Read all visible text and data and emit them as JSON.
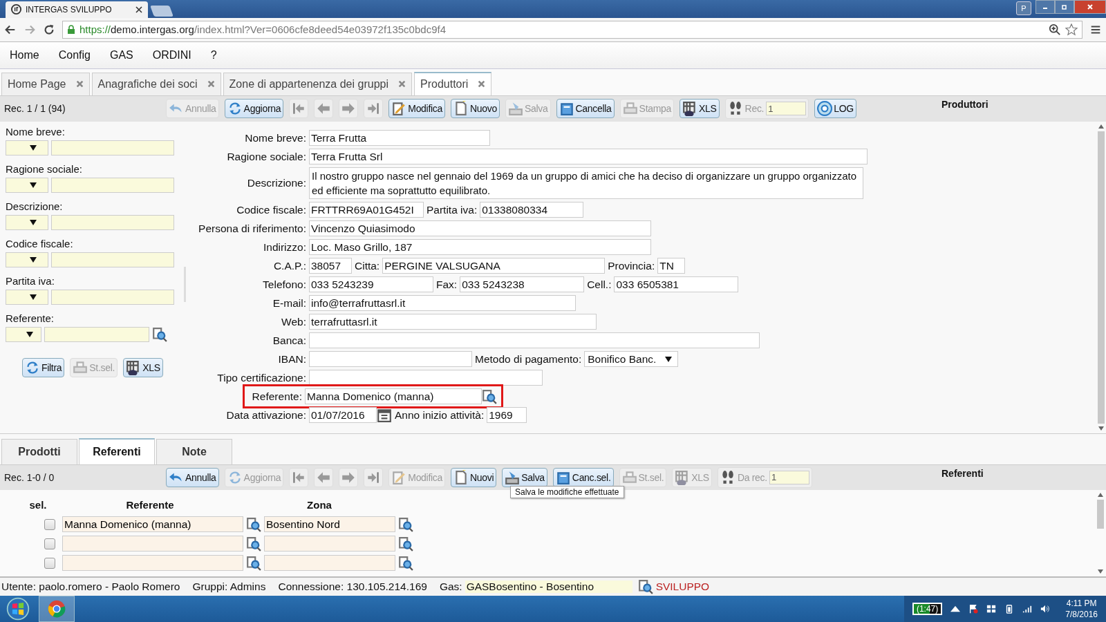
{
  "browser": {
    "tab_title": "INTERGAS SVILUPPO",
    "profile": "P",
    "url_scheme": "https://",
    "url_host": "demo.intergas.org",
    "url_path": "/index.html?Ver=0606cfe8deed54e03972f135c0bdc9f4"
  },
  "menu": [
    "Home",
    "Config",
    "GAS",
    "ORDINI",
    "?"
  ],
  "tabs": [
    {
      "label": "Home Page",
      "selected": false
    },
    {
      "label": "Anagrafiche dei soci",
      "selected": false
    },
    {
      "label": "Zone di appartenenza dei gruppi",
      "selected": false
    },
    {
      "label": "Produttori",
      "selected": true
    }
  ],
  "toolbar": {
    "record": "Rec. 1 / 1 (94)",
    "title": "Produttori",
    "items": [
      {
        "kind": "button",
        "label": "Annulla",
        "disabled": true
      },
      {
        "kind": "button",
        "label": "Aggiorna",
        "disabled": false
      },
      {
        "kind": "nav"
      },
      {
        "kind": "nav"
      },
      {
        "kind": "nav"
      },
      {
        "kind": "nav"
      },
      {
        "kind": "button",
        "label": "Modifica",
        "disabled": false
      },
      {
        "kind": "button",
        "label": "Nuovo",
        "disabled": false
      },
      {
        "kind": "button",
        "label": "Salva",
        "disabled": true
      },
      {
        "kind": "button",
        "label": "Cancella",
        "disabled": false
      },
      {
        "kind": "button",
        "label": "Stampa",
        "disabled": true
      },
      {
        "kind": "button",
        "label": "XLS",
        "disabled": false
      },
      {
        "kind": "rec",
        "label": "Rec.",
        "value": "1"
      },
      {
        "kind": "button",
        "label": "LOG",
        "disabled": false
      }
    ]
  },
  "filters": {
    "items": [
      {
        "kind": "text",
        "label": "Nome breve:"
      },
      {
        "kind": "text",
        "label": "Ragione sociale:"
      },
      {
        "kind": "text",
        "label": "Descrizione:"
      },
      {
        "kind": "text",
        "label": "Codice fiscale:"
      },
      {
        "kind": "text",
        "label": "Partita iva:"
      },
      {
        "kind": "lookup",
        "label": "Referente:"
      }
    ],
    "buttons": [
      {
        "label": "Filtra",
        "disabled": false
      },
      {
        "label": "St.sel.",
        "disabled": true
      },
      {
        "label": "XLS",
        "disabled": false
      }
    ]
  },
  "form": {
    "rows": [
      {
        "fields": [
          {
            "kind": "text",
            "label": "Nome breve:",
            "value": "Terra Frutta"
          }
        ]
      },
      {
        "fields": [
          {
            "kind": "text",
            "label": "Ragione sociale:",
            "value": "Terra Frutta Srl"
          }
        ]
      },
      {
        "fields": [
          {
            "kind": "textarea",
            "label": "Descrizione:",
            "value": "Il nostro gruppo nasce nel gennaio del 1969 da un gruppo di amici che ha deciso di organizzare un gruppo organizzato ed efficiente ma soprattutto equilibrato."
          }
        ]
      },
      {
        "fields": [
          {
            "kind": "text",
            "label": "Codice fiscale:",
            "value": "FRTTRR69A01G452I"
          },
          {
            "kind": "text",
            "label": "Partita iva:",
            "value": "01338080334"
          }
        ]
      },
      {
        "fields": [
          {
            "kind": "text",
            "label": "Persona di riferimento:",
            "value": "Vincenzo Quiasimodo"
          }
        ]
      },
      {
        "fields": [
          {
            "kind": "text",
            "label": "Indirizzo:",
            "value": "Loc. Maso Grillo, 187"
          }
        ]
      },
      {
        "fields": [
          {
            "kind": "text",
            "label": "C.A.P.:",
            "value": "38057"
          },
          {
            "kind": "text",
            "label": "Citta:",
            "value": "PERGINE VALSUGANA"
          },
          {
            "kind": "text",
            "label": "Provincia:",
            "value": "TN"
          }
        ]
      },
      {
        "fields": [
          {
            "kind": "text",
            "label": "Telefono:",
            "value": "033 5243239"
          },
          {
            "kind": "text",
            "label": "Fax:",
            "value": "033 5243238"
          },
          {
            "kind": "text",
            "label": "Cell.:",
            "value": "033 6505381"
          }
        ]
      },
      {
        "fields": [
          {
            "kind": "text",
            "label": "E-mail:",
            "value": "info@terrafruttasrl.it"
          }
        ]
      },
      {
        "fields": [
          {
            "kind": "text",
            "label": "Web:",
            "value": "terrafruttasrl.it"
          }
        ]
      },
      {
        "fields": [
          {
            "kind": "text",
            "label": "Banca:"
          }
        ]
      },
      {
        "fields": [
          {
            "kind": "text",
            "label": "IBAN:"
          },
          {
            "kind": "select",
            "label": "Metodo di pagamento:",
            "value": "Bonifico Banc."
          }
        ]
      },
      {
        "fields": [
          {
            "kind": "text",
            "label": "Tipo certificazione:"
          }
        ]
      },
      {
        "fields": [
          {
            "kind": "lookup",
            "label": "Referente:",
            "value": "Manna Domenico (manna)",
            "highlighted": true
          }
        ]
      },
      {
        "fields": [
          {
            "kind": "date",
            "label": "Data attivazione:",
            "value": "01/07/2016"
          },
          {
            "kind": "text",
            "label": "Anno inizio attività:",
            "value": "1969"
          }
        ]
      }
    ]
  },
  "subtabs": [
    {
      "label": "Prodotti",
      "selected": false
    },
    {
      "label": "Referenti",
      "selected": true
    },
    {
      "label": "Note",
      "selected": false
    }
  ],
  "subtoolbar": {
    "record": "Rec. 1-0 / 0",
    "title": "Referenti",
    "tooltip": "Salva le modifiche effettuate",
    "items": [
      {
        "kind": "button",
        "label": "Annulla",
        "disabled": false
      },
      {
        "kind": "button",
        "label": "Aggiorna",
        "disabled": true
      },
      {
        "kind": "nav"
      },
      {
        "kind": "nav"
      },
      {
        "kind": "nav"
      },
      {
        "kind": "nav"
      },
      {
        "kind": "button",
        "label": "Modifica",
        "disabled": true
      },
      {
        "kind": "button",
        "label": "Nuovi",
        "disabled": false
      },
      {
        "kind": "button",
        "label": "Salva",
        "disabled": false
      },
      {
        "kind": "button",
        "label": "Canc.sel.",
        "disabled": false
      },
      {
        "kind": "button",
        "label": "St.sel.",
        "disabled": true
      },
      {
        "kind": "button",
        "label": "XLS",
        "disabled": true
      },
      {
        "kind": "rec",
        "label": "Da rec.",
        "value": "1"
      }
    ]
  },
  "grid": {
    "columns": [
      "sel.",
      "Referente",
      "Zona"
    ],
    "rows": [
      {
        "checked": false,
        "referente": "Manna Domenico (manna)",
        "zona": "Bosentino Nord"
      },
      {
        "checked": false
      },
      {
        "checked": false
      }
    ]
  },
  "status": {
    "user": "Utente: paolo.romero - Paolo Romero",
    "groups": "Gruppi: Admins",
    "connection": "Connessione: 130.105.214.169",
    "gas_label": "Gas:",
    "gas_value": "GASBosentino - Bosentino",
    "env": "SVILUPPO"
  },
  "taskbar": {
    "battery": "(1:47)",
    "time": "4:11 PM",
    "date": "7/8/2016"
  }
}
